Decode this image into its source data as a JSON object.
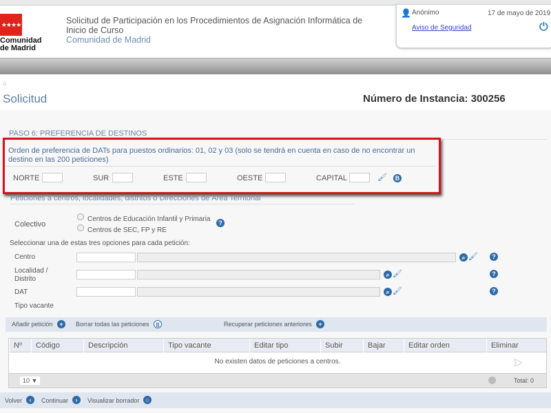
{
  "header": {
    "logo_text": "Comunidad de Madrid",
    "title": "Solicitud de Participación en los Procedimientos de Asignación Informática de Inicio de Curso",
    "org": "Comunidad de Madrid",
    "user": "Anónimo",
    "date": "17 de mayo de 2019",
    "security_link": "Aviso de Seguridad"
  },
  "page": {
    "title": "Solicitud",
    "instance": "Número de Instancia: 300256"
  },
  "step": {
    "title": "PASO 6: PREFERENCIA DE DESTINOS",
    "dat_text": "Orden de preferencia de DATs para puestos ordinarios: 01, 02 y 03 (solo se tendrá en cuenta en caso de no encontrar un destino en las 200 peticiones)",
    "zones": [
      "NORTE",
      "SUR",
      "ESTE",
      "OESTE",
      "CAPITAL"
    ]
  },
  "peticiones": {
    "title": "Peticiones a centros, localidades, distritos o Direcciones de Área Territorial",
    "colectivo_label": "Colectivo",
    "options": [
      "Centros de Educación Infantil y Primaria",
      "Centros de SEC, FP y RE"
    ],
    "instruction": "Seleccionar una de estas tres opciones para cada petición:",
    "fields": [
      "Centro",
      "Localidad / Distrito",
      "DAT"
    ],
    "tipo_vacante": "Tipo vacante"
  },
  "actions": {
    "add": "Añadir petición",
    "clear": "Borrar todas las peticiones",
    "recover": "Recuperar peticiones anteriores"
  },
  "table": {
    "columns": [
      "Nº",
      "Código",
      "Descripción",
      "Tipo vacante",
      "Editar tipo",
      "Subir",
      "Bajar",
      "Editar orden",
      "Eliminar"
    ],
    "empty": "No existen datos de peticiones a centros.",
    "page_size": "10 ▼",
    "total": "Total: 0"
  },
  "footer": {
    "back": "Volver",
    "continue": "Continuar",
    "preview": "Visualizar borrador"
  }
}
